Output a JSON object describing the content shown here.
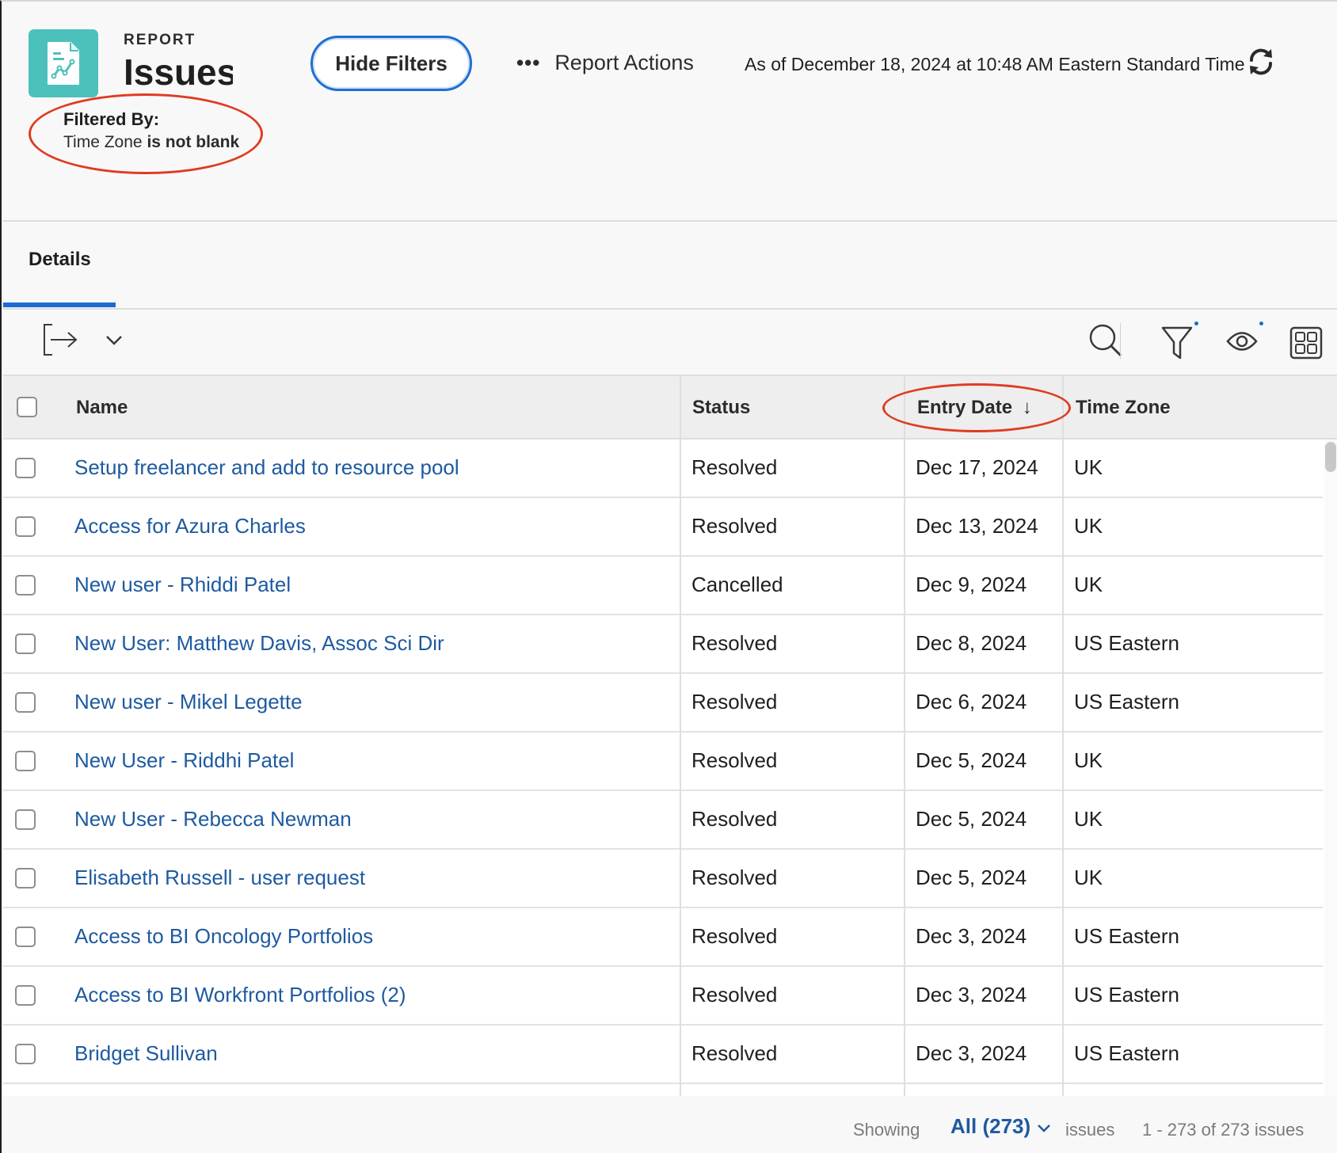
{
  "header": {
    "kicker": "REPORT",
    "title": "Issues with Time Zone",
    "hide_filters_label": "Hide Filters",
    "report_actions_label": "Report Actions",
    "as_of": "As of December 18, 2024 at 10:48 AM Eastern Standard Time",
    "filtered_by_label": "Filtered By:",
    "filter_field": "Time Zone",
    "filter_condition": "is not blank"
  },
  "tabs": [
    {
      "label": "Details",
      "active": true
    }
  ],
  "table": {
    "columns": [
      "Name",
      "Status",
      "Entry Date",
      "Time Zone"
    ],
    "sort_indicator": "↓",
    "rows": [
      {
        "name": "Setup freelancer and add to resource pool",
        "status": "Resolved",
        "entry_date": "Dec 17, 2024",
        "time_zone": "UK"
      },
      {
        "name": "Access for Azura Charles",
        "status": "Resolved",
        "entry_date": "Dec 13, 2024",
        "time_zone": "UK"
      },
      {
        "name": "New user - Rhiddi Patel",
        "status": "Cancelled",
        "entry_date": "Dec 9, 2024",
        "time_zone": "UK"
      },
      {
        "name": "New User: Matthew Davis, Assoc Sci Dir",
        "status": "Resolved",
        "entry_date": "Dec 8, 2024",
        "time_zone": "US Eastern"
      },
      {
        "name": "New user - Mikel Legette",
        "status": "Resolved",
        "entry_date": "Dec 6, 2024",
        "time_zone": "US Eastern"
      },
      {
        "name": "New User - Riddhi Patel",
        "status": "Resolved",
        "entry_date": "Dec 5, 2024",
        "time_zone": "UK"
      },
      {
        "name": "New User - Rebecca Newman",
        "status": "Resolved",
        "entry_date": "Dec 5, 2024",
        "time_zone": "UK"
      },
      {
        "name": "Elisabeth Russell - user request",
        "status": "Resolved",
        "entry_date": "Dec 5, 2024",
        "time_zone": "UK"
      },
      {
        "name": "Access to BI Oncology Portfolios",
        "status": "Resolved",
        "entry_date": "Dec 3, 2024",
        "time_zone": "US Eastern"
      },
      {
        "name": "Access to BI Workfront Portfolios (2)",
        "status": "Resolved",
        "entry_date": "Dec 3, 2024",
        "time_zone": "US Eastern"
      },
      {
        "name": "Bridget Sullivan",
        "status": "Resolved",
        "entry_date": "Dec 3, 2024",
        "time_zone": "US Eastern"
      }
    ]
  },
  "footer": {
    "showing_label": "Showing",
    "selected_view": "All (273)",
    "issues_label": "issues",
    "range": "1 - 273 of 273 issues"
  },
  "colors": {
    "accent": "#1b6bd2",
    "link": "#1e5aa0",
    "report_icon_bg": "#4cc1bc",
    "annotation": "#e03b22"
  },
  "icons": [
    "report-chart-icon",
    "more-dots-icon",
    "refresh-icon",
    "export-icon",
    "chevron-down-icon",
    "search-icon",
    "filter-icon",
    "eye-icon",
    "grid-icon"
  ]
}
